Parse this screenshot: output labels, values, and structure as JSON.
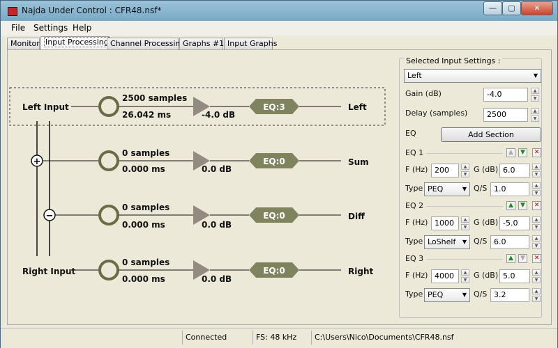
{
  "window": {
    "title": "Najda Under Control : CFR48.nsf*"
  },
  "window_controls": {
    "minimize": "—",
    "maximize": "▢",
    "close": "✕"
  },
  "menu": {
    "items": [
      "File",
      "Settings",
      "Help"
    ]
  },
  "tabs": [
    "Monitor",
    "Input Processing",
    "Channel Processing",
    "Graphs #1",
    "Input Graphs"
  ],
  "active_tab": "Input Processing",
  "diagram": {
    "left_input": "Left Input",
    "right_input": "Right Input",
    "sum_symbol": "+",
    "diff_symbol": "−",
    "channels": [
      {
        "samples": "2500 samples",
        "ms": "26.042 ms",
        "gain": "-4.0 dB",
        "eq": "EQ:3",
        "output": "Left"
      },
      {
        "samples": "0 samples",
        "ms": "0.000 ms",
        "gain": "0.0 dB",
        "eq": "EQ:0",
        "output": "Sum"
      },
      {
        "samples": "0 samples",
        "ms": "0.000 ms",
        "gain": "0.0 dB",
        "eq": "EQ:0",
        "output": "Diff"
      },
      {
        "samples": "0 samples",
        "ms": "0.000 ms",
        "gain": "0.0 dB",
        "eq": "EQ:0",
        "output": "Right"
      }
    ]
  },
  "settings": {
    "title": "Selected Input Settings :",
    "selected_input": "Left",
    "gain_label": "Gain (dB)",
    "gain_value": "-4.0",
    "delay_label": "Delay (samples)",
    "delay_value": "2500",
    "eq_label": "EQ",
    "add_section": "Add Section",
    "f_label": "F (Hz)",
    "g_label": "G (dB)",
    "type_label": "Type",
    "qs_label": "Q/S",
    "eq_sections": [
      {
        "name": "EQ 1",
        "f": "200",
        "g": "6.0",
        "type": "PEQ",
        "qs": "1.0"
      },
      {
        "name": "EQ 2",
        "f": "1000",
        "g": "-5.0",
        "type": "LoShelf",
        "qs": "6.0"
      },
      {
        "name": "EQ 3",
        "f": "4000",
        "g": "5.0",
        "type": "PEQ",
        "qs": "3.2"
      }
    ]
  },
  "status": {
    "connection": "Connected",
    "fs": "FS: 48 kHz",
    "path": "C:\\Users\\Nico\\Documents\\CFR48.nsf"
  },
  "colors": {
    "ring": "#6b6b45",
    "triangle": "#938a82",
    "eq_fill": "#7f845e"
  }
}
